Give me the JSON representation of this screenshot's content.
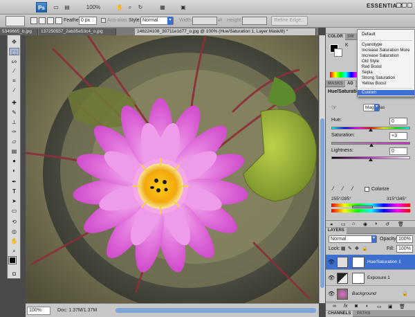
{
  "app": {
    "logo": "Ps",
    "zoom_menu": "100%",
    "workspace": "ESSENTIALS"
  },
  "options_bar": {
    "feather_label": "Feather:",
    "feather_value": "0 px",
    "anti_alias_label": "Anti-alias",
    "style_label": "Style:",
    "style_value": "Normal",
    "width_label": "Width:",
    "height_label": "Height:",
    "refine_edge_label": "Refine Edge..."
  },
  "document_tabs": [
    {
      "label": "5349665_b.jpg",
      "active": false
    },
    {
      "label": "137250557_2ab35e53c4_o.jpg",
      "active": false
    },
    {
      "label": "148224108_30711e1d77_o.jpg @ 100% (Hue/Saturation 1, Layer Mask/8) *",
      "active": true
    }
  ],
  "status_bar": {
    "zoom": "100%",
    "doc_info": "Doc: 1.37M/1.37M"
  },
  "panels": {
    "top_tabs": [
      "COLOR",
      "SW"
    ],
    "adjust_tabs": [
      "MASKS",
      "AD"
    ],
    "hue_sat_title": "Hue/Saturation",
    "preset_menu": {
      "items": [
        "Default",
        "Cyanotype",
        "Increase Saturation More",
        "Increase Saturation",
        "Old Style",
        "Red Boost",
        "Sepia",
        "Strong Saturation",
        "Yellow Boost",
        "Custom"
      ],
      "selected": "Custom"
    },
    "channel_select": "Magentas",
    "hue_label": "Hue:",
    "hue_value": "0",
    "saturation_label": "Saturation:",
    "saturation_value": "+3",
    "lightness_label": "Lightness:",
    "lightness_value": "0",
    "colorize_label": "Colorize",
    "range_left": "255°/285°",
    "range_right": "315°\\345°"
  },
  "layers_panel": {
    "title": "LAYERS",
    "blend_mode": "Normal",
    "opacity_label": "Opacity:",
    "opacity_value": "100%",
    "lock_label": "Lock:",
    "fill_label": "Fill:",
    "fill_value": "100%",
    "layers": [
      {
        "name": "Hue/Saturation 1",
        "selected": true
      },
      {
        "name": "Exposure 1",
        "selected": false
      },
      {
        "name": "Background",
        "selected": false
      }
    ],
    "bottom_tabs": [
      "CHANNELS",
      "PATHS"
    ]
  },
  "colors": {
    "selection_blue": "#3d6fd0",
    "panel_gray": "#c7c7c7",
    "flower_pink": "#e56ad9"
  }
}
